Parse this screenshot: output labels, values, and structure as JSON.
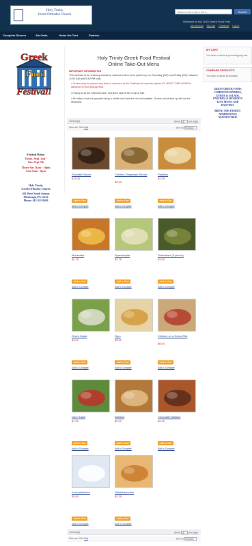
{
  "header": {
    "logo_line1": "Holy Trinity",
    "logo_line2": "Greek Orthodox Church",
    "search_placeholder": "Search entire store here...",
    "search_button": "Search",
    "welcome": "Welcome to the 2010 Greek Food Fest",
    "links": [
      "My Account",
      "My Cart",
      "Checkout",
      "Log In"
    ]
  },
  "nav": [
    "Complete Dinners",
    "Ala Carte",
    "Under the Tent",
    "Pastries"
  ],
  "sidebar": {
    "logo_words": [
      "Greek",
      "Food",
      "Festival!"
    ],
    "dates_title": "Festival Dates:",
    "date1": "Thurs. Sept. 2nd -",
    "date2": "Sun. Sept 5th",
    "hours1": "Thurs-Sat 11am - 10pm",
    "hours2": "Sun 11am - 6pm",
    "church1": "Holy Trinity",
    "church2": "Greek Orthodox Church",
    "addr1": "301 West North Avenue",
    "addr2": "Pittsburgh, PA 15212",
    "phone": "Phone: 412-321-9160"
  },
  "main": {
    "title1": "Holy Trinity Greek Food Festival",
    "title2": "Online Take-Out Menu",
    "important": "IMPORTANT INFORMATION",
    "intro": "This website is for ordering ahead for takeout orders to be picked up on Thursday (9/2) and Friday (9/3) between 11:00 AM and 5:30 PM only.",
    "notice": "Orders may be placed any time in advance of the Festival but must be placed AT LEAST ONE HOUR in advance of your pickup time.",
    "bullet2": "Pickup is at the Sherman Ave. entrance side of the church hall.",
    "bullet3": "All orders must be prepaid using a credit card and are non-refundable. Orders not picked up will not be refunded."
  },
  "toolbar": {
    "items": "14 Item(s)",
    "show": "Show",
    "per_page_value": "15",
    "per_page": "per page",
    "view_as": "View as: Grid",
    "view_list": "List",
    "sort_by": "Sort by",
    "sort_value": "Position"
  },
  "products": [
    {
      "name": "Souvlaki Dinner",
      "price": "$11.00"
    },
    {
      "name": "Chicken Oreganato Dinner",
      "price": "$9.00"
    },
    {
      "name": "Pastitsio",
      "price": "$4.25"
    },
    {
      "name": "Moussaka",
      "price": "$4.75"
    },
    {
      "name": "Spanakopita",
      "price": "$3.75"
    },
    {
      "name": "Dolmathes (5 pieces)",
      "price": "$3.00"
    },
    {
      "name": "Greek Salad",
      "price": "$3.00"
    },
    {
      "name": "Gyro",
      "price": "$5.50"
    },
    {
      "name": "Chicken a La Greca Pita",
      "price": "$6.00"
    },
    {
      "name": "Gyro Salad",
      "price": "$7.50"
    },
    {
      "name": "Baklava",
      "price": "$2.00"
    },
    {
      "name": "Chocolate Baklava",
      "price": "$2.25"
    },
    {
      "name": "Kourambiethes",
      "price": "$3.00"
    },
    {
      "name": "Galaktoboureko",
      "price": "$2.25"
    }
  ],
  "labels": {
    "add_to_cart": "Add to Cart",
    "add_to_compare": "Add to Compare"
  },
  "right": {
    "cart_title": "MY CART",
    "cart_text": "You have no items in your shopping cart.",
    "compare_title": "COMPARE PRODUCTS",
    "compare_text": "You have no items to compare.",
    "promo": [
      "GREAT GREEK FOOD:",
      "COMPLETE DINNERS,",
      "GYROS & SALADS,",
      "PASTRIES & DESSERTS",
      "LIVE MUSIC AND",
      "DANCING!",
      "BRING THE FAMILY!",
      "ADMISSION IS",
      "ALWAYS FREE!"
    ]
  },
  "colors": {
    "header": "#12314f",
    "accent": "#f39a1b",
    "price": "#c21d1d",
    "link": "#1a3c8a"
  }
}
